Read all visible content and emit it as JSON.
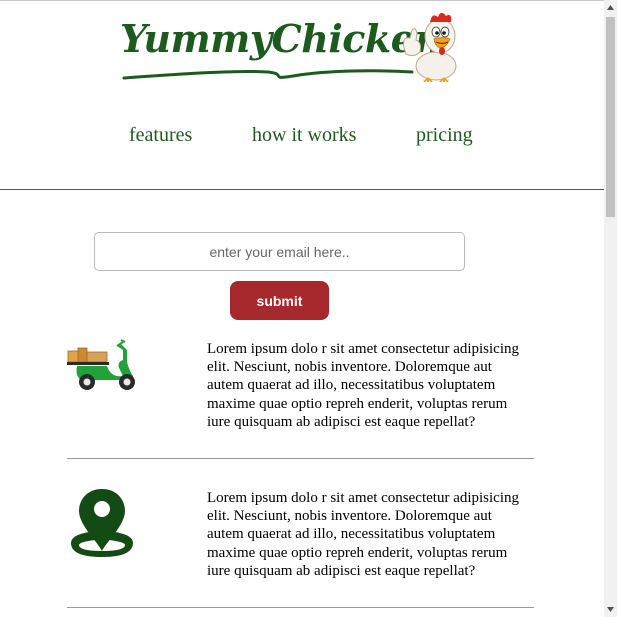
{
  "header": {
    "logo_text": "YummyChicken",
    "nav": [
      {
        "label": "features"
      },
      {
        "label": "how it works"
      },
      {
        "label": "pricing"
      }
    ]
  },
  "form": {
    "email_placeholder": "enter your email here..",
    "submit_label": "submit"
  },
  "features": [
    {
      "icon": "delivery-scooter-icon",
      "text": "Lorem ipsum dolo r sit amet consectetur adipisicing elit. Nesciunt, nobis inventore. Doloremque aut autem quaerat ad illo, necessitatibus voluptatem maxime quae optio repreh enderit, voluptas rerum iure quisquam ab adipisci est eaque repellat?"
    },
    {
      "icon": "map-pin-icon",
      "text": "Lorem ipsum dolo r sit amet consectetur adipisicing elit. Nesciunt, nobis inventore. Doloremque aut autem quaerat ad illo, necessitatibus voluptatem maxime quae optio repreh enderit, voluptas rerum iure quisquam ab adipisci est eaque repellat?"
    }
  ],
  "colors": {
    "brand_green": "#1d5a1d",
    "submit_red": "#a7282c"
  }
}
